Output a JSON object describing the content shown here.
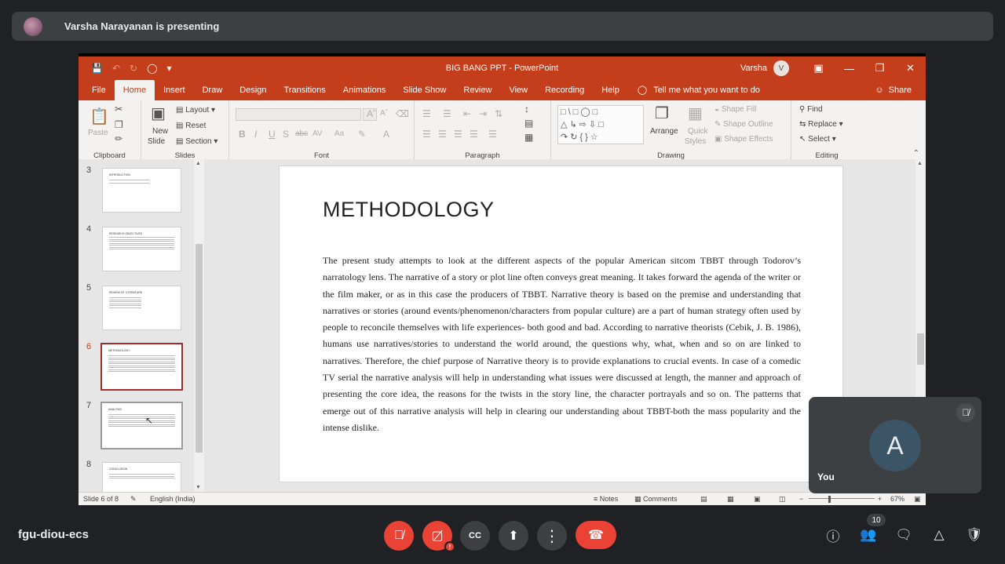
{
  "presenter_bar": {
    "text": "Varsha Narayanan is presenting"
  },
  "ppt": {
    "window_title": "BIG BANG PPT  -  PowerPoint",
    "user_name": "Varsha",
    "user_initial": "V",
    "tabs": [
      "File",
      "Home",
      "Insert",
      "Draw",
      "Design",
      "Transitions",
      "Animations",
      "Slide Show",
      "Review",
      "View",
      "Recording",
      "Help"
    ],
    "active_tab": "Home",
    "tell_me": "Tell me what you want to do",
    "share": "Share",
    "ribbon": {
      "clipboard": {
        "paste": "Paste",
        "label": "Clipboard"
      },
      "slides": {
        "new_slide_1": "New",
        "new_slide_2": "Slide",
        "layout": "Layout",
        "reset": "Reset",
        "section": "Section",
        "label": "Slides"
      },
      "font": {
        "label": "Font"
      },
      "paragraph": {
        "label": "Paragraph"
      },
      "drawing": {
        "arrange": "Arrange",
        "quick_styles_1": "Quick",
        "quick_styles_2": "Styles",
        "shape_fill": "Shape Fill",
        "shape_outline": "Shape Outline",
        "shape_effects": "Shape Effects",
        "label": "Drawing"
      },
      "editing": {
        "find": "Find",
        "replace": "Replace",
        "select": "Select",
        "label": "Editing"
      }
    },
    "thumbnails": [
      {
        "num": "3",
        "title": "INTRODUCTION"
      },
      {
        "num": "4",
        "title": "RESEARCH OBJECTIVES"
      },
      {
        "num": "5",
        "title": "REVIEW OF LITERATURE"
      },
      {
        "num": "6",
        "title": "METHODOLOGY"
      },
      {
        "num": "7",
        "title": "ANALYSIS"
      },
      {
        "num": "8",
        "title": "CONCLUSION"
      }
    ],
    "slide": {
      "title": "METHODOLOGY",
      "body": "The present study attempts to look at the different aspects of the popular American sitcom TBBT through Todorov’s narratology lens. The narrative of a story or plot line often conveys great meaning. It takes forward the agenda of the writer or the film maker, or as in this case the producers of TBBT. Narrative theory is based on the premise and understanding that narratives or stories (around events/phenomenon/characters from popular culture) are a part of human strategy often used by people to reconcile themselves with life experiences- both good and bad. According to narrative theorists (Cebik, J. B. 1986), humans use narratives/stories to understand the world around, the questions why, what, when and so on are linked to narratives. Therefore, the chief purpose of Narrative theory is to provide explanations to crucial events. In case of a comedic TV serial the narrative analysis will help in understanding what issues were discussed at length, the manner and approach of presenting the core idea, the reasons for the twists in the story line, the character portrayals and so on. The patterns that emerge out of this narrative analysis will help in clearing our understanding about TBBT-both the mass popularity and the intense dislike."
    },
    "status": {
      "slide_indicator": "Slide 6 of 8",
      "language": "English (India)",
      "notes": "Notes",
      "comments": "Comments",
      "zoom": "67%"
    }
  },
  "self_tile": {
    "initial": "A",
    "name": "You"
  },
  "meeting": {
    "code": "fgu-diou-ecs",
    "participants_count": "10"
  },
  "colors": {
    "ppt_accent": "#c43e1c",
    "meet_red": "#ea4335",
    "meet_bg": "#202124"
  }
}
